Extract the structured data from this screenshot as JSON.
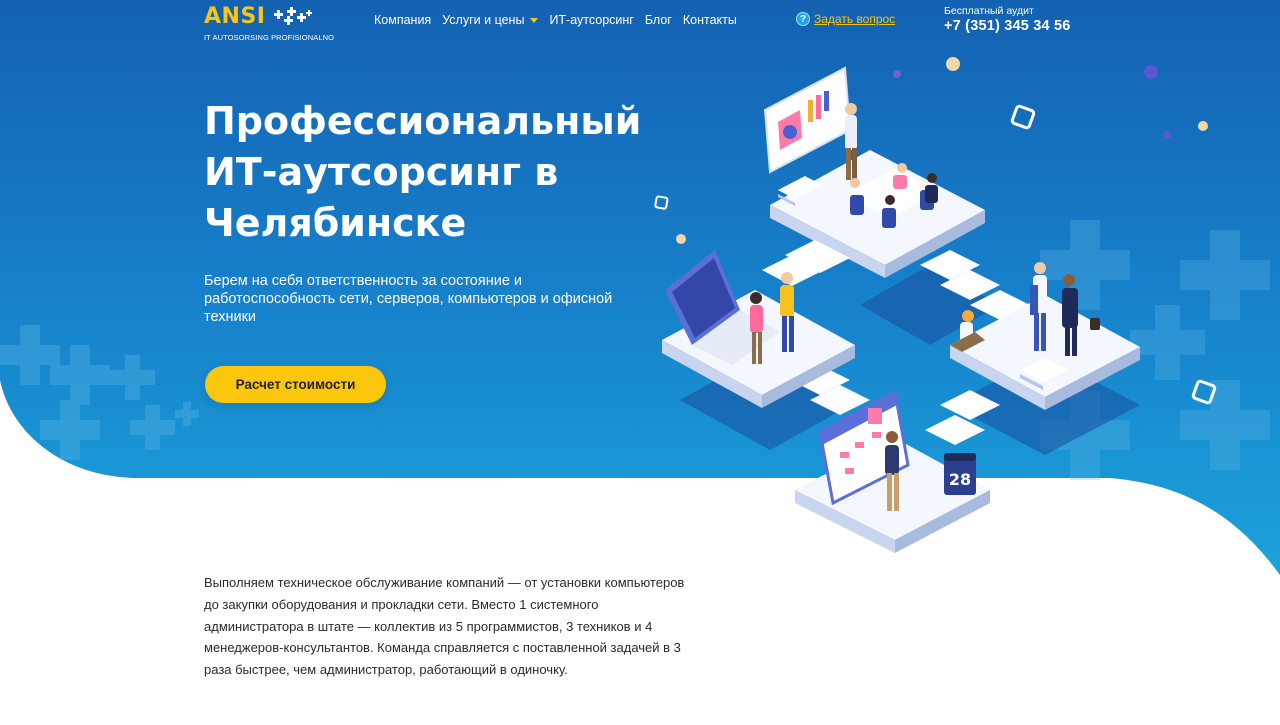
{
  "colors": {
    "hero_top": "#1466b6",
    "hero_bottom": "#1a9ad6",
    "accent_yellow": "#fcc60c",
    "white": "#ffffff",
    "body_text": "#2a2a2a"
  },
  "logo": {
    "word": "ANSI",
    "tagline": "IT AUTOSORSING PROFISIONALNO"
  },
  "nav": {
    "items": [
      {
        "label": "Компания"
      },
      {
        "label": "Услуги и цены",
        "has_dropdown": true
      },
      {
        "label": "ИТ-аутсорсинг"
      },
      {
        "label": "Блог"
      },
      {
        "label": "Контакты"
      }
    ]
  },
  "ask": {
    "icon": "question-icon",
    "icon_glyph": "?",
    "label": "Задать вопрос"
  },
  "contact": {
    "audit_label": "Бесплатный аудит",
    "phone": "+7 (351) 345 34 56"
  },
  "hero": {
    "title_lines": [
      "Профессиональный",
      "ИТ-аутсорсинг в",
      "Челябинске"
    ],
    "subtitle": "Берем на себя ответственность за состояние и работоспособность сети, серверов, компьютеров и офисной техники",
    "cta_label": "Расчет стоимости"
  },
  "illustration": {
    "calendar_day": "28"
  },
  "body": {
    "paragraph": "Выполняем техническое обслуживание компаний — от установки компьютеров до закупки оборудования и прокладки сети. Вместо 1 системного администратора в штате — коллектив из 5 программистов, 3 техников и 4 менеджеров-консультантов. Команда справляется с поставленной задачей в 3 раза быстрее, чем администратор, работающий в одиночку."
  }
}
